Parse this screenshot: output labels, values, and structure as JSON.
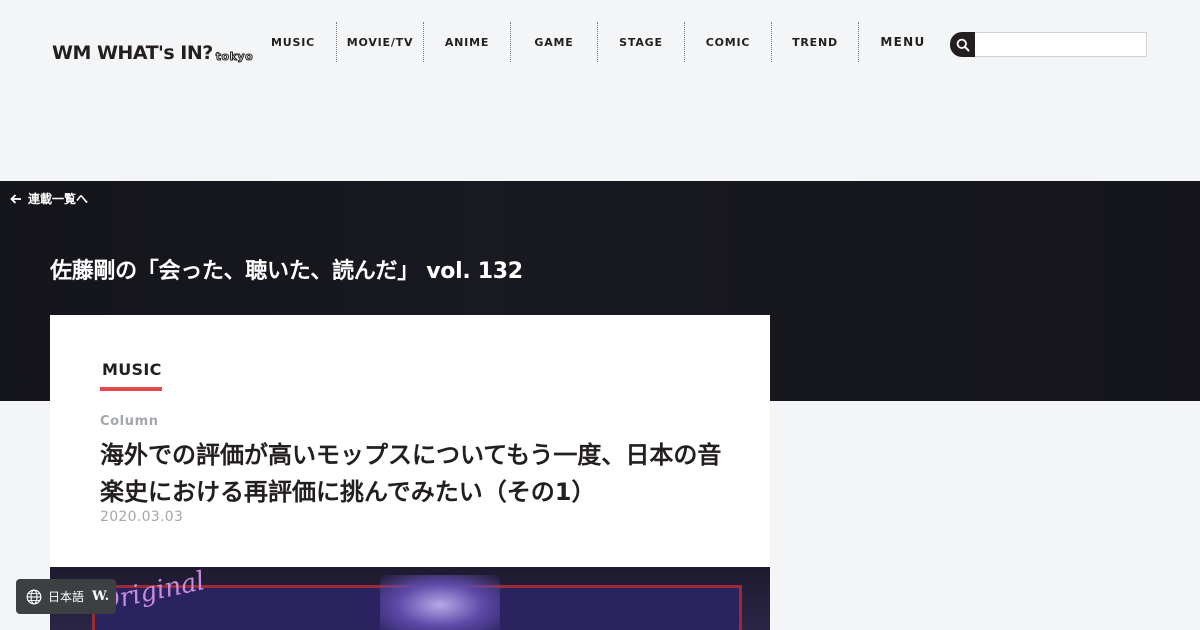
{
  "header": {
    "logo_main": "WM WHAT's IN?",
    "logo_sub": "tokyo",
    "nav": [
      "MUSIC",
      "MOVIE/TV",
      "ANIME",
      "GAME",
      "STAGE",
      "COMIC",
      "TREND",
      "MENU"
    ],
    "search_placeholder": ""
  },
  "hero": {
    "back_label": "連載一覧へ",
    "series_title": "佐藤剛の「会った、聴いた、読んだ」 vol. 132"
  },
  "article": {
    "category": "MUSIC",
    "type": "Column",
    "title": "海外での評価が高いモップスについてもう一度、日本の音楽史における再評価に挑んでみたい（その1）",
    "date": "2020.03.03"
  },
  "lang_switcher": {
    "label": "日本語",
    "logo": "W."
  },
  "colors": {
    "background": "#f4f5f7",
    "brand_dark": "#231f20",
    "accent": "#e8474c",
    "muted_text": "#a3a6ab"
  },
  "icons": {
    "search": "search-icon",
    "back": "arrow-left-icon",
    "globe": "globe-icon"
  }
}
